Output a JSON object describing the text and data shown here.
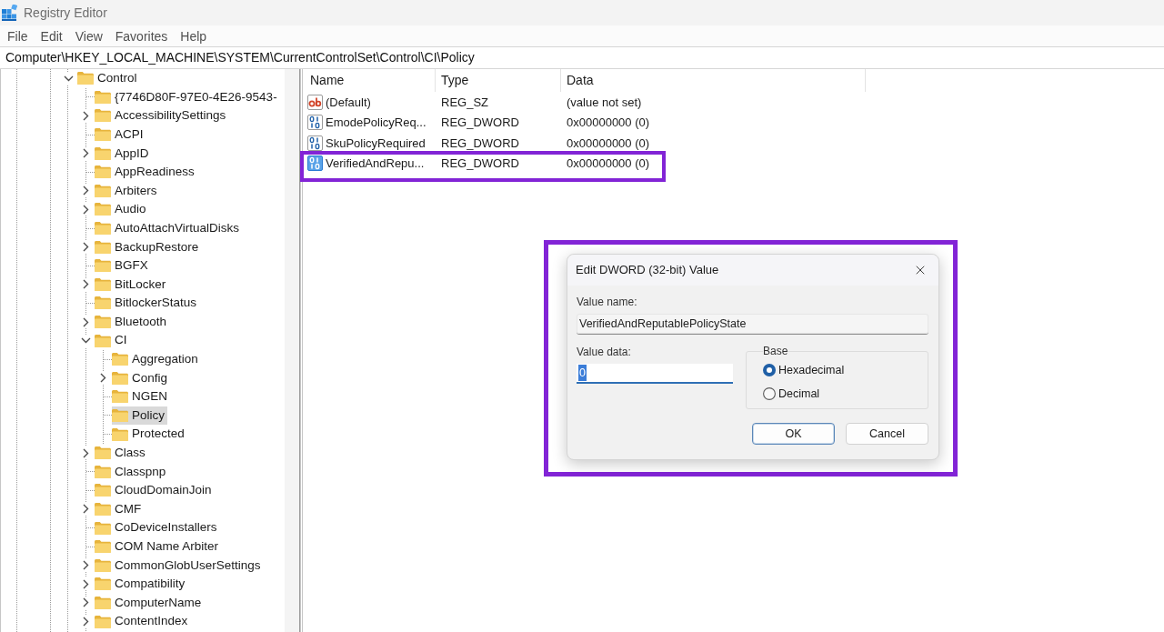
{
  "window": {
    "title": "Registry Editor"
  },
  "menu": [
    "File",
    "Edit",
    "View",
    "Favorites",
    "Help"
  ],
  "address": "Computer\\HKEY_LOCAL_MACHINE\\SYSTEM\\CurrentControlSet\\Control\\CI\\Policy",
  "tree": [
    {
      "label": "Control",
      "expandable": true,
      "expanded": true,
      "selected": false,
      "children": [
        {
          "label": "{7746D80F-97E0-4E26-9543-",
          "expandable": false,
          "expanded": false,
          "selected": false
        },
        {
          "label": "AccessibilitySettings",
          "expandable": true,
          "expanded": false,
          "selected": false
        },
        {
          "label": "ACPI",
          "expandable": false,
          "expanded": false,
          "selected": false
        },
        {
          "label": "AppID",
          "expandable": true,
          "expanded": false,
          "selected": false
        },
        {
          "label": "AppReadiness",
          "expandable": false,
          "expanded": false,
          "selected": false
        },
        {
          "label": "Arbiters",
          "expandable": true,
          "expanded": false,
          "selected": false
        },
        {
          "label": "Audio",
          "expandable": true,
          "expanded": false,
          "selected": false
        },
        {
          "label": "AutoAttachVirtualDisks",
          "expandable": false,
          "expanded": false,
          "selected": false
        },
        {
          "label": "BackupRestore",
          "expandable": true,
          "expanded": false,
          "selected": false
        },
        {
          "label": "BGFX",
          "expandable": false,
          "expanded": false,
          "selected": false
        },
        {
          "label": "BitLocker",
          "expandable": true,
          "expanded": false,
          "selected": false
        },
        {
          "label": "BitlockerStatus",
          "expandable": false,
          "expanded": false,
          "selected": false
        },
        {
          "label": "Bluetooth",
          "expandable": true,
          "expanded": false,
          "selected": false
        },
        {
          "label": "CI",
          "expandable": true,
          "expanded": true,
          "selected": false,
          "children": [
            {
              "label": "Aggregation",
              "expandable": false,
              "expanded": false,
              "selected": false
            },
            {
              "label": "Config",
              "expandable": true,
              "expanded": false,
              "selected": false
            },
            {
              "label": "NGEN",
              "expandable": false,
              "expanded": false,
              "selected": false
            },
            {
              "label": "Policy",
              "expandable": false,
              "expanded": false,
              "selected": true
            },
            {
              "label": "Protected",
              "expandable": false,
              "expanded": false,
              "selected": false
            }
          ]
        },
        {
          "label": "Class",
          "expandable": true,
          "expanded": false,
          "selected": false
        },
        {
          "label": "Classpnp",
          "expandable": false,
          "expanded": false,
          "selected": false
        },
        {
          "label": "CloudDomainJoin",
          "expandable": false,
          "expanded": false,
          "selected": false
        },
        {
          "label": "CMF",
          "expandable": true,
          "expanded": false,
          "selected": false
        },
        {
          "label": "CoDeviceInstallers",
          "expandable": false,
          "expanded": false,
          "selected": false
        },
        {
          "label": "COM Name Arbiter",
          "expandable": false,
          "expanded": false,
          "selected": false
        },
        {
          "label": "CommonGlobUserSettings",
          "expandable": true,
          "expanded": false,
          "selected": false
        },
        {
          "label": "Compatibility",
          "expandable": true,
          "expanded": false,
          "selected": false
        },
        {
          "label": "ComputerName",
          "expandable": true,
          "expanded": false,
          "selected": false
        },
        {
          "label": "ContentIndex",
          "expandable": true,
          "expanded": false,
          "selected": false
        }
      ]
    }
  ],
  "values": {
    "columns": [
      "Name",
      "Type",
      "Data"
    ],
    "rows": [
      {
        "kind": "string",
        "name": "(Default)",
        "type": "REG_SZ",
        "data": "(value not set)",
        "selected": false,
        "highlighted": false
      },
      {
        "kind": "dword",
        "name": "EmodePolicyReq...",
        "type": "REG_DWORD",
        "data": "0x00000000 (0)",
        "selected": false,
        "highlighted": false
      },
      {
        "kind": "dword",
        "name": "SkuPolicyRequired",
        "type": "REG_DWORD",
        "data": "0x00000000 (0)",
        "selected": false,
        "highlighted": false
      },
      {
        "kind": "dword",
        "name": "VerifiedAndRepu...",
        "type": "REG_DWORD",
        "data": "0x00000000 (0)",
        "selected": true,
        "highlighted": true
      }
    ]
  },
  "dialog": {
    "title": "Edit DWORD (32-bit) Value",
    "highlighted": true,
    "value_name_label": "Value name:",
    "value_name": "VerifiedAndReputablePolicyState",
    "value_data_label": "Value data:",
    "value_data": "0",
    "value_data_selected": true,
    "base": {
      "label": "Base",
      "options": [
        {
          "label": "Hexadecimal",
          "selected": true
        },
        {
          "label": "Decimal",
          "selected": false
        }
      ]
    },
    "buttons": [
      {
        "label": "OK",
        "default": true
      },
      {
        "label": "Cancel",
        "default": false
      }
    ]
  }
}
